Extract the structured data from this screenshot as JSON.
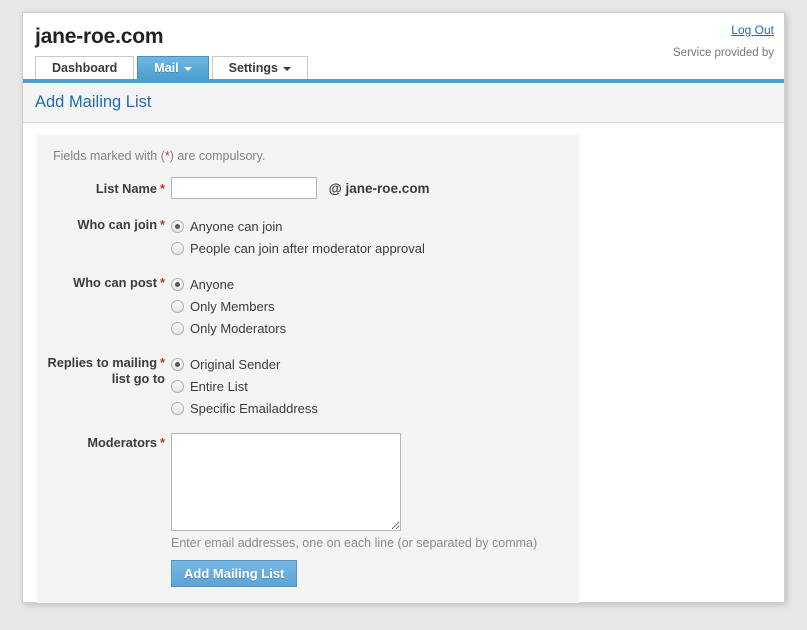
{
  "header": {
    "site_title": "jane-roe.com",
    "logout_label": "Log Out",
    "service_text": "Service provided by",
    "tabs": [
      {
        "label": "Dashboard",
        "active": false,
        "has_caret": false
      },
      {
        "label": "Mail",
        "active": true,
        "has_caret": true
      },
      {
        "label": "Settings",
        "active": false,
        "has_caret": true
      }
    ]
  },
  "page": {
    "title": "Add Mailing List"
  },
  "form": {
    "compulsory_note_prefix": "Fields marked with (",
    "compulsory_note_star": "*",
    "compulsory_note_suffix": ") are compulsory.",
    "required_marker": "*",
    "list_name": {
      "label": "List Name",
      "value": "",
      "placeholder": "",
      "suffix": "@ jane-roe.com"
    },
    "who_can_join": {
      "label": "Who can join",
      "options": [
        {
          "label": "Anyone can join",
          "selected": true
        },
        {
          "label": "People can join after moderator approval",
          "selected": false
        }
      ]
    },
    "who_can_post": {
      "label": "Who can post",
      "options": [
        {
          "label": "Anyone",
          "selected": true
        },
        {
          "label": "Only Members",
          "selected": false
        },
        {
          "label": "Only Moderators",
          "selected": false
        }
      ]
    },
    "replies_go_to": {
      "label_line1": "Replies to mailing",
      "label_line2": "list go to",
      "options": [
        {
          "label": "Original Sender",
          "selected": true
        },
        {
          "label": "Entire List",
          "selected": false
        },
        {
          "label": "Specific Emailaddress",
          "selected": false
        }
      ]
    },
    "moderators": {
      "label": "Moderators",
      "value": "",
      "placeholder": "",
      "hint": "Enter email addresses, one on each line (or separated by comma)"
    },
    "submit_label": "Add Mailing List"
  },
  "colors": {
    "accent_blue": "#4f9fd0",
    "link_blue": "#1f6bb0",
    "required_red": "#c0392b",
    "panel_gray": "#f4f4f4",
    "page_bg": "#e8e8e8"
  }
}
